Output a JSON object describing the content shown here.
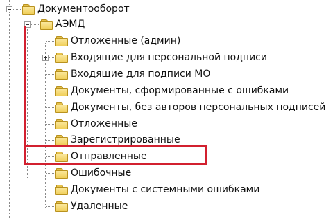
{
  "tree": {
    "root": {
      "label": "Документооборот",
      "expanded": true
    },
    "folder": {
      "label": "АЭМД",
      "expanded": true
    },
    "items": [
      {
        "label": "Отложенные (админ)",
        "has_children": false
      },
      {
        "label": "Входящие для персональной подписи",
        "has_children": true
      },
      {
        "label": "Входящие для подписи МО",
        "has_children": false
      },
      {
        "label": "Документы, сформированные с ошибками",
        "has_children": false
      },
      {
        "label": "Документы, без авторов персональных подписей",
        "has_children": false
      },
      {
        "label": "Отложенные",
        "has_children": false
      },
      {
        "label": "Зарегистрированные",
        "has_children": false
      },
      {
        "label": "Отправленные",
        "has_children": false,
        "highlighted": true
      },
      {
        "label": "Ошибочные",
        "has_children": false
      },
      {
        "label": "Документы с системными ошибками",
        "has_children": false
      },
      {
        "label": "Удаленные",
        "has_children": false
      }
    ]
  },
  "annotation": {
    "color": "#d2202f",
    "highlighted_item": "Отправленные"
  }
}
